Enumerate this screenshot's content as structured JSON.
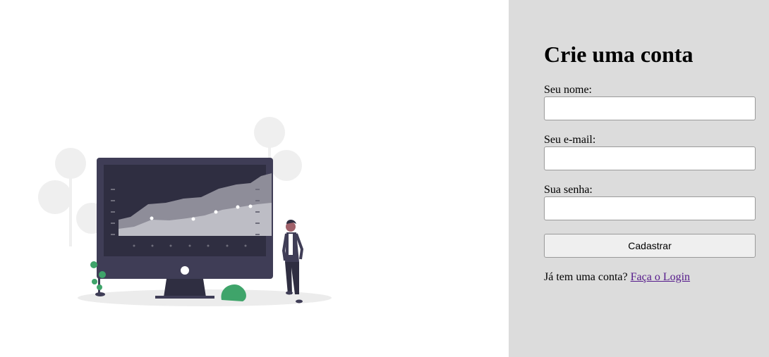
{
  "signup": {
    "title": "Crie uma conta",
    "fields": [
      {
        "label": "Seu nome:",
        "value": ""
      },
      {
        "label": "Seu e-mail:",
        "value": ""
      },
      {
        "label": "Sua senha:",
        "value": ""
      }
    ],
    "submit_label": "Cadastrar",
    "login_prompt": "Já tem uma conta?",
    "login_link": "Faça o Login"
  },
  "illustration": {
    "name": "dashboard-illustration",
    "colors": {
      "monitor": "#3f3d56",
      "screen": "#2f2e41",
      "chart_light": "#bdbdc5",
      "chart_dark": "#8e8d99",
      "plant": "#3fa46a",
      "foliage": "#efefef",
      "shadow": "#ececec"
    }
  }
}
